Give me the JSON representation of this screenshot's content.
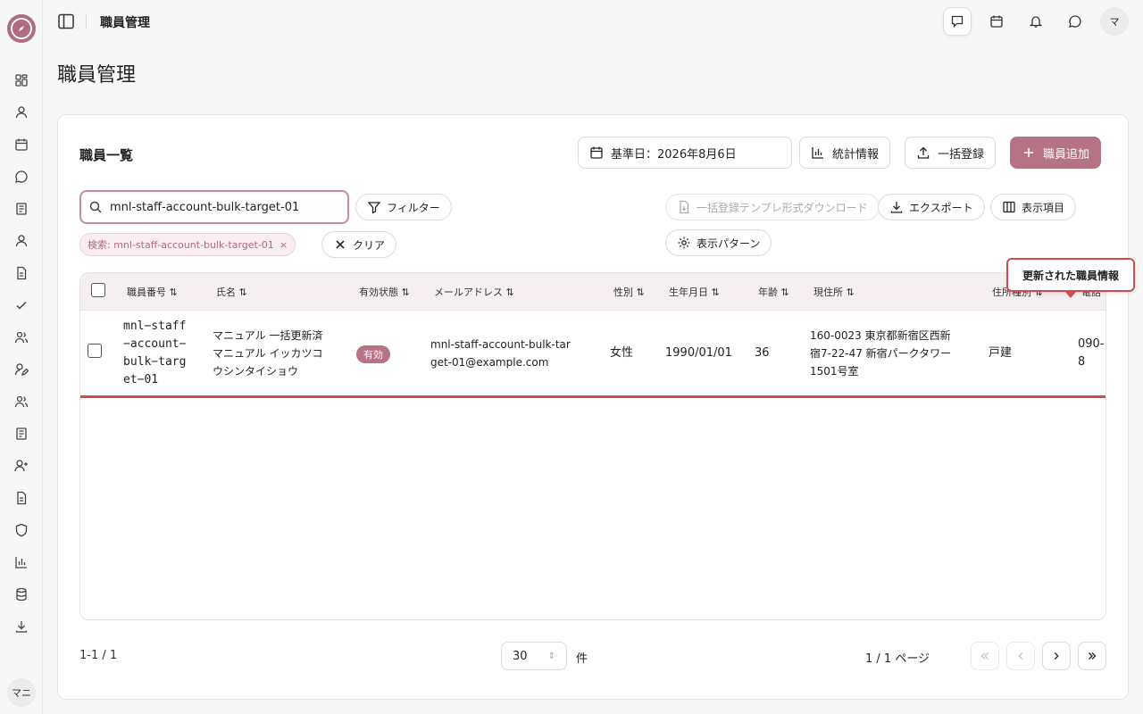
{
  "header": {
    "breadcrumb": "職員管理",
    "avatar_initial": "マ"
  },
  "sidebar": {
    "avatar_initial": "マニ"
  },
  "page": {
    "title": "職員管理"
  },
  "card": {
    "title": "職員一覧",
    "date_button": "基準日：2026年8月6日",
    "stats_button": "統計情報",
    "bulk_register_button": "一括登録",
    "add_staff_button": "職員追加"
  },
  "toolbar": {
    "search_value": "mnl-staff-account-bulk-target-01",
    "filter_button": "フィルター",
    "template_download_button": "一括登録テンプレ形式ダウンロード",
    "export_button": "エクスポート",
    "columns_button": "表示項目",
    "pattern_button": "表示パターン",
    "chip_label": "検索: mnl-staff-account-bulk-target-01",
    "clear_button": "クリア"
  },
  "table": {
    "headers": [
      "職員番号 ⇅",
      "氏名 ⇅",
      "有効状態 ⇅",
      "メールアドレス ⇅",
      "性別 ⇅",
      "生年月日 ⇅",
      "年齢 ⇅",
      "現住所 ⇅",
      "住所種別 ⇅",
      "電話"
    ],
    "row": {
      "staff_no": [
        "mnl−staff",
        "−account−",
        "bulk−targ",
        "et−01"
      ],
      "name": [
        "マニュアル 一括更新済",
        "マニュアル イッカツコ",
        "ウシンタイショウ"
      ],
      "status": "有効",
      "email": [
        "mnl-staff-account-bulk-tar",
        "get-01@example.com"
      ],
      "gender": "女性",
      "birth": "1990/01/01",
      "age": "36",
      "address": [
        "160-0023 東京都新宿区西新",
        "宿7-22-47 新宿パークタワー",
        "1501号室"
      ],
      "address_type": "戸建",
      "phone": [
        "090-",
        "8"
      ]
    }
  },
  "tooltip": "更新された職員情報",
  "pagination": {
    "range": "1-1 / 1",
    "page_size": "30",
    "page_size_unit": "件",
    "page_info": "1 / 1 ページ"
  },
  "colors": {
    "accent": "#b57385",
    "highlight": "#d34a4a"
  }
}
